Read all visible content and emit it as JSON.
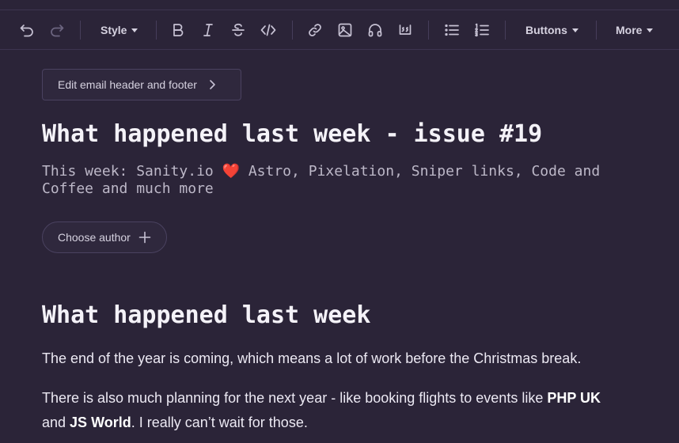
{
  "toolbar": {
    "style_label": "Style",
    "buttons_label": "Buttons",
    "more_label": "More",
    "icons": [
      "undo-icon",
      "redo-icon",
      "bold-icon",
      "italic-icon",
      "strikethrough-icon",
      "code-icon",
      "link-icon",
      "image-icon",
      "headphones-icon",
      "quote-icon",
      "bullet-list-icon",
      "numbered-list-icon",
      "chevron-down-icon"
    ]
  },
  "editor": {
    "header_footer_label": "Edit email header and footer",
    "title": "What happened last week - issue #19",
    "subtitle_before": "This week: Sanity.io ",
    "subtitle_heart": "❤️",
    "subtitle_after": " Astro, Pixelation, Sniper links, Code and Coffee and much more",
    "choose_author_label": "Choose author",
    "section_heading": "What happened last week",
    "paragraph1": "The end of the year is coming, which means a lot of work before the Christmas break.",
    "paragraph2": {
      "part1": "There is also much planning for the next year - like booking flights to events like ",
      "bold1": "PHP UK",
      "part2": " and ",
      "bold2": "JS World",
      "part3": ". I really can’t wait for those."
    }
  },
  "colors": {
    "background": "#2b2438",
    "text": "#ece9f3",
    "muted_text": "#bdb8c8",
    "heart": "#e0233d",
    "border": "#4a4260"
  }
}
